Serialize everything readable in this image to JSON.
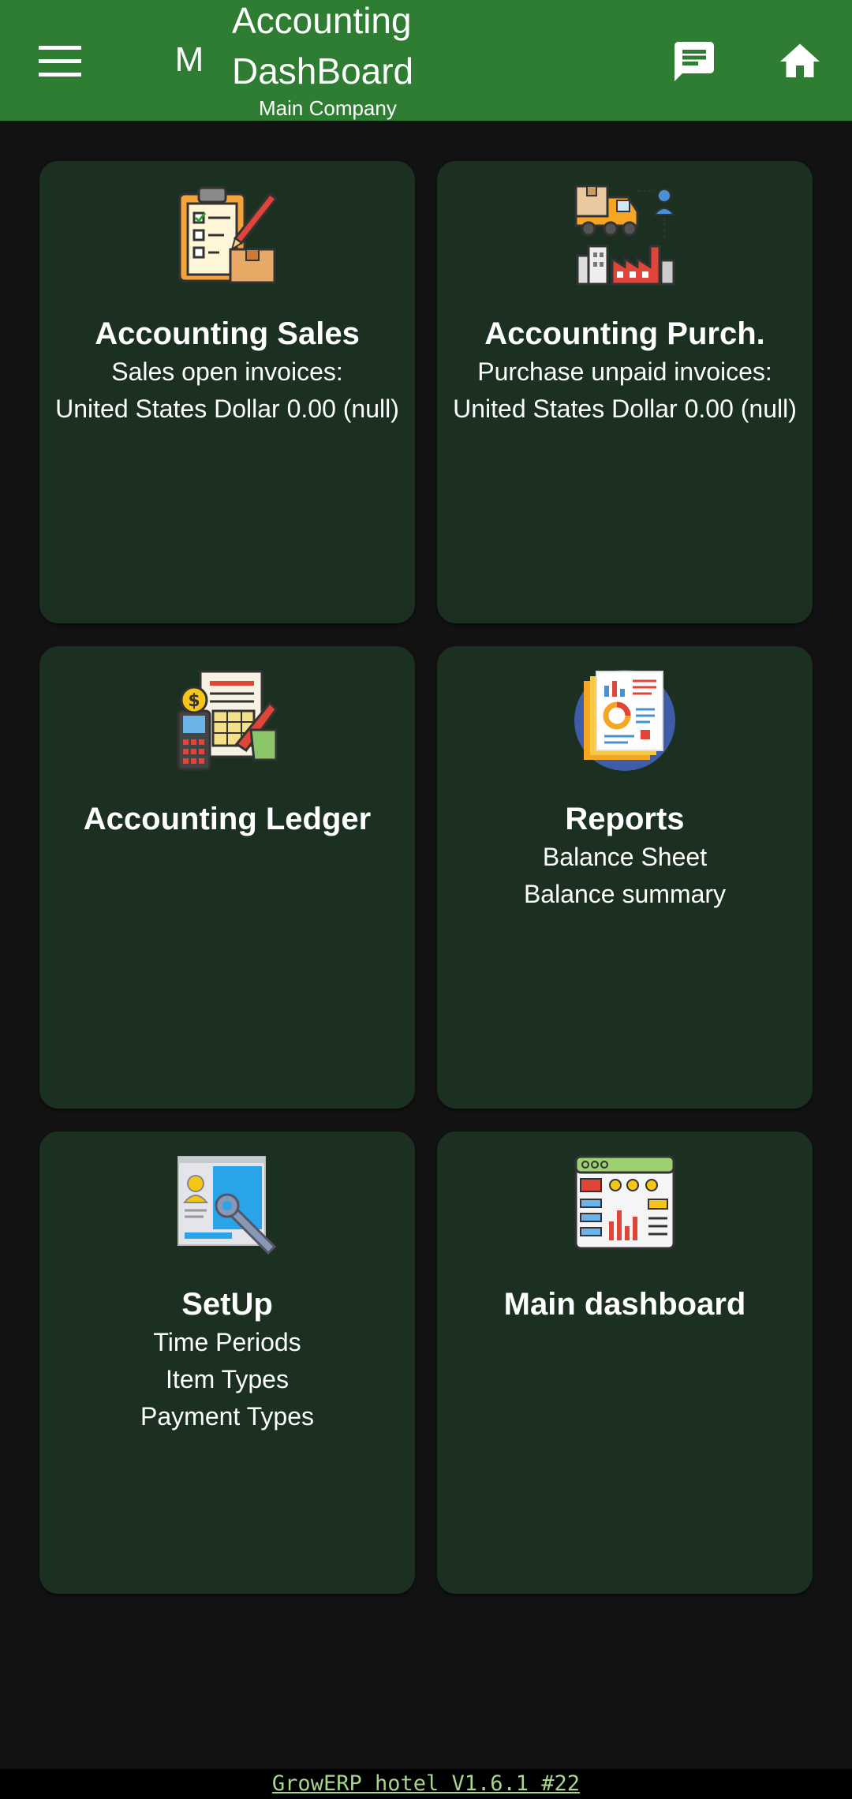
{
  "appbar": {
    "company_letter": "M",
    "title": "Accounting\nDashBoard",
    "subtitle": "Main Company",
    "menu_icon": "menu-icon",
    "chat_icon": "chat-icon",
    "home_icon": "home-icon"
  },
  "cards": [
    {
      "title": "Accounting Sales",
      "lines": [
        "Sales open invoices:",
        "United States Dollar 0.00 (null)"
      ],
      "icon": "clipboard-checklist-icon"
    },
    {
      "title": "Accounting Purch.",
      "lines": [
        "Purchase unpaid invoices:",
        "United States Dollar 0.00 (null)"
      ],
      "icon": "delivery-truck-factory-icon"
    },
    {
      "title": "Accounting Ledger",
      "lines": [],
      "icon": "ledger-calculator-icon"
    },
    {
      "title": "Reports",
      "lines": [
        "Balance Sheet",
        "Balance summary"
      ],
      "icon": "report-documents-icon"
    },
    {
      "title": "SetUp",
      "lines": [
        "Time Periods",
        "Item Types",
        "Payment Types"
      ],
      "icon": "setup-wrench-icon"
    },
    {
      "title": "Main dashboard",
      "lines": [],
      "icon": "dashboard-window-icon"
    }
  ],
  "footer": {
    "version_text": "GrowERP hotel V1.6.1 #22"
  },
  "colors": {
    "appbar": "#2e7d32",
    "background": "#121212",
    "card": "#1b3021",
    "footer_link": "#a5d68a"
  }
}
